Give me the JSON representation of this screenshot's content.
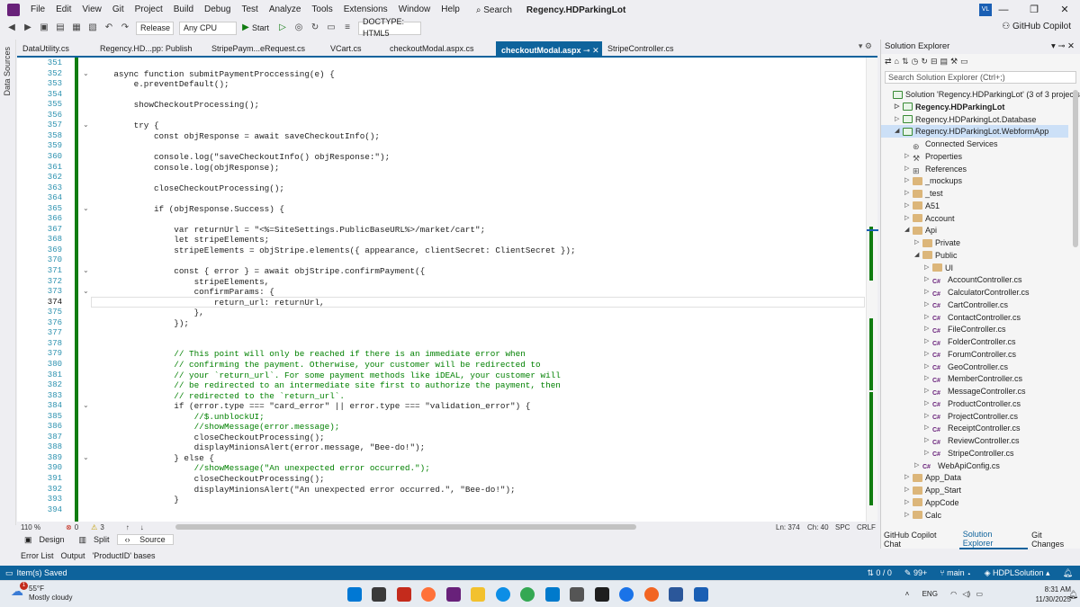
{
  "menu": {
    "items": [
      "File",
      "Edit",
      "View",
      "Git",
      "Project",
      "Build",
      "Debug",
      "Test",
      "Analyze",
      "Tools",
      "Extensions",
      "Window",
      "Help"
    ],
    "search": "Search",
    "solution_title": "Regency.HDParkingLot",
    "avatar": "VL"
  },
  "toolbar": {
    "config": "Release",
    "platform": "Any CPU",
    "start": "Start",
    "doctype": "DOCTYPE: HTML5",
    "copilot": "GitHub Copilot"
  },
  "left_strip": {
    "label": "Data Sources"
  },
  "tabs": [
    {
      "label": "DataUtility.cs"
    },
    {
      "label": "Regency.HD...pp: Publish"
    },
    {
      "label": "StripePaym...eRequest.cs"
    },
    {
      "label": "VCart.cs"
    },
    {
      "label": "checkoutModal.aspx.cs"
    },
    {
      "label": "checkoutModal.aspx"
    },
    {
      "label": "StripeController.cs"
    }
  ],
  "editor": {
    "lines": [
      {
        "n": "351",
        "t": ""
      },
      {
        "n": "352",
        "t": "    async function submitPaymentProccessing(e) {"
      },
      {
        "n": "353",
        "t": "        e.preventDefault();"
      },
      {
        "n": "354",
        "t": ""
      },
      {
        "n": "355",
        "t": "        showCheckoutProcessing();"
      },
      {
        "n": "356",
        "t": ""
      },
      {
        "n": "357",
        "t": "        try {"
      },
      {
        "n": "358",
        "t": "            const objResponse = await saveCheckoutInfo();"
      },
      {
        "n": "359",
        "t": ""
      },
      {
        "n": "360",
        "t": "            console.log(\"saveCheckoutInfo() objResponse:\");"
      },
      {
        "n": "361",
        "t": "            console.log(objResponse);"
      },
      {
        "n": "362",
        "t": ""
      },
      {
        "n": "363",
        "t": "            closeCheckoutProcessing();"
      },
      {
        "n": "364",
        "t": ""
      },
      {
        "n": "365",
        "t": "            if (objResponse.Success) {"
      },
      {
        "n": "366",
        "t": ""
      },
      {
        "n": "367",
        "t": "                var returnUrl = \"<%=SiteSettings.PublicBaseURL%>/market/cart\";"
      },
      {
        "n": "368",
        "t": "                let stripeElements;"
      },
      {
        "n": "369",
        "t": "                stripeElements = objStripe.elements({ appearance, clientSecret: ClientSecret });"
      },
      {
        "n": "370",
        "t": ""
      },
      {
        "n": "371",
        "t": "                const { error } = await objStripe.confirmPayment({"
      },
      {
        "n": "372",
        "t": "                    stripeElements,"
      },
      {
        "n": "373",
        "t": "                    confirmParams: {"
      },
      {
        "n": "374",
        "t": "                        return_url: returnUrl,"
      },
      {
        "n": "375",
        "t": "                    },"
      },
      {
        "n": "376",
        "t": "                });"
      },
      {
        "n": "377",
        "t": ""
      },
      {
        "n": "378",
        "t": ""
      },
      {
        "n": "379",
        "t": "                // This point will only be reached if there is an immediate error when"
      },
      {
        "n": "380",
        "t": "                // confirming the payment. Otherwise, your customer will be redirected to"
      },
      {
        "n": "381",
        "t": "                // your `return_url`. For some payment methods like iDEAL, your customer will"
      },
      {
        "n": "382",
        "t": "                // be redirected to an intermediate site first to authorize the payment, then"
      },
      {
        "n": "383",
        "t": "                // redirected to the `return_url`."
      },
      {
        "n": "384",
        "t": "                if (error.type === \"card_error\" || error.type === \"validation_error\") {"
      },
      {
        "n": "385",
        "t": "                    //$.unblockUI;"
      },
      {
        "n": "386",
        "t": "                    //showMessage(error.message);"
      },
      {
        "n": "387",
        "t": "                    closeCheckoutProcessing();"
      },
      {
        "n": "388",
        "t": "                    displayMinionsAlert(error.message, \"Bee-do!\");"
      },
      {
        "n": "389",
        "t": "                } else {"
      },
      {
        "n": "390",
        "t": "                    //showMessage(\"An unexpected error occurred.\");"
      },
      {
        "n": "391",
        "t": "                    closeCheckoutProcessing();"
      },
      {
        "n": "392",
        "t": "                    displayMinionsAlert(\"An unexpected error occurred.\", \"Bee-do!\");"
      },
      {
        "n": "393",
        "t": "                }"
      },
      {
        "n": "394",
        "t": ""
      }
    ],
    "current_line": "374"
  },
  "editor_status": {
    "zoom": "110 %",
    "errors": "0",
    "warnings": "3",
    "ln": "Ln: 374",
    "ch": "Ch: 40",
    "spc": "SPC",
    "crlf": "CRLF"
  },
  "view_tabs": [
    "Design",
    "Split",
    "Source"
  ],
  "bottom_tabs": [
    "Error List",
    "Output",
    "'ProductID' bases"
  ],
  "solution_explorer": {
    "title": "Solution Explorer",
    "search_placeholder": "Search Solution Explorer (Ctrl+;)",
    "items": [
      {
        "label": "Solution 'Regency.HDParkingLot' (3 of 3 projects)",
        "indent": 0,
        "icon": "solution"
      },
      {
        "label": "Regency.HDParkingLot",
        "indent": 1,
        "icon": "project",
        "bold": true
      },
      {
        "label": "Regency.HDParkingLot.Database",
        "indent": 1,
        "icon": "project"
      },
      {
        "label": "Regency.HDParkingLot.WebformApp",
        "indent": 1,
        "icon": "project",
        "selected": true
      },
      {
        "label": "Connected Services",
        "indent": 2,
        "icon": "service"
      },
      {
        "label": "Properties",
        "indent": 2,
        "icon": "wrench"
      },
      {
        "label": "References",
        "indent": 2,
        "icon": "refs"
      },
      {
        "label": "_mockups",
        "indent": 2,
        "icon": "folder"
      },
      {
        "label": "_test",
        "indent": 2,
        "icon": "folder"
      },
      {
        "label": "A51",
        "indent": 2,
        "icon": "folder"
      },
      {
        "label": "Account",
        "indent": 2,
        "icon": "folder"
      },
      {
        "label": "Api",
        "indent": 2,
        "icon": "folder"
      },
      {
        "label": "Private",
        "indent": 3,
        "icon": "folder"
      },
      {
        "label": "Public",
        "indent": 3,
        "icon": "folder"
      },
      {
        "label": "UI",
        "indent": 4,
        "icon": "folder"
      },
      {
        "label": "AccountController.cs",
        "indent": 4,
        "icon": "cs"
      },
      {
        "label": "CalculatorController.cs",
        "indent": 4,
        "icon": "cs"
      },
      {
        "label": "CartController.cs",
        "indent": 4,
        "icon": "cs"
      },
      {
        "label": "ContactController.cs",
        "indent": 4,
        "icon": "cs"
      },
      {
        "label": "FileController.cs",
        "indent": 4,
        "icon": "cs"
      },
      {
        "label": "FolderController.cs",
        "indent": 4,
        "icon": "cs"
      },
      {
        "label": "ForumController.cs",
        "indent": 4,
        "icon": "cs"
      },
      {
        "label": "GeoController.cs",
        "indent": 4,
        "icon": "cs"
      },
      {
        "label": "MemberController.cs",
        "indent": 4,
        "icon": "cs"
      },
      {
        "label": "MessageController.cs",
        "indent": 4,
        "icon": "cs"
      },
      {
        "label": "ProductController.cs",
        "indent": 4,
        "icon": "cs"
      },
      {
        "label": "ProjectController.cs",
        "indent": 4,
        "icon": "cs"
      },
      {
        "label": "ReceiptController.cs",
        "indent": 4,
        "icon": "cs"
      },
      {
        "label": "ReviewController.cs",
        "indent": 4,
        "icon": "cs"
      },
      {
        "label": "StripeController.cs",
        "indent": 4,
        "icon": "cs"
      },
      {
        "label": "WebApiConfig.cs",
        "indent": 3,
        "icon": "cs"
      },
      {
        "label": "App_Data",
        "indent": 2,
        "icon": "folder"
      },
      {
        "label": "App_Start",
        "indent": 2,
        "icon": "folder"
      },
      {
        "label": "AppCode",
        "indent": 2,
        "icon": "folder"
      },
      {
        "label": "Calc",
        "indent": 2,
        "icon": "folder"
      }
    ],
    "tabs": [
      "GitHub Copilot Chat",
      "Solution Explorer",
      "Git Changes"
    ]
  },
  "statusbar": {
    "message": "Item(s) Saved",
    "errors": "0 / 0",
    "pencil": "99+",
    "branch": "main",
    "solution": "HDPLSolution"
  },
  "taskbar": {
    "temp": "55°F",
    "weather": "Mostly cloudy",
    "badge": "1",
    "lang": "ENG",
    "time": "8:31 AM",
    "date": "11/30/2025"
  },
  "colors": {
    "accent": "#0e639c",
    "change_bar": "#107c10",
    "comment": "#008000",
    "line_number": "#2b91af"
  }
}
